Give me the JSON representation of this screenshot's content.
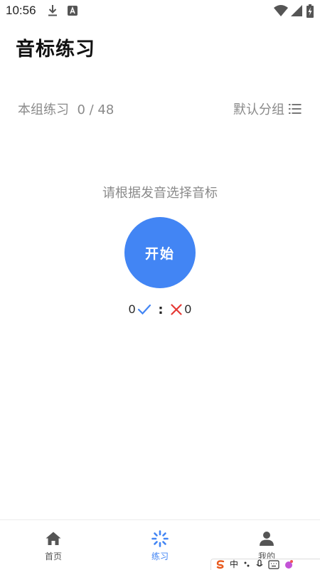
{
  "status_bar": {
    "time": "10:56",
    "icons": [
      "download-icon",
      "app-badge-icon",
      "wifi-icon",
      "cell-signal-icon",
      "battery-charging-icon"
    ]
  },
  "page": {
    "title": "音标练习"
  },
  "group": {
    "progress_label": "本组练习",
    "progress_value": "0 / 48",
    "selector_label": "默认分组",
    "selector_icon": "list-icon"
  },
  "main": {
    "instruction": "请根据发音选择音标",
    "start_label": "开始",
    "start_color": "#4285f4"
  },
  "score": {
    "correct": "0",
    "separator": ":",
    "wrong": "0",
    "correct_color": "#4285f4",
    "wrong_color": "#e53935"
  },
  "bottom_nav": {
    "items": [
      {
        "label": "首页",
        "icon": "home-icon",
        "active": false
      },
      {
        "label": "练习",
        "icon": "practice-icon",
        "active": true
      },
      {
        "label": "我的",
        "icon": "person-icon",
        "active": false
      }
    ],
    "active_color": "#4285f4"
  },
  "ime_bar": {
    "items": [
      "中"
    ]
  }
}
